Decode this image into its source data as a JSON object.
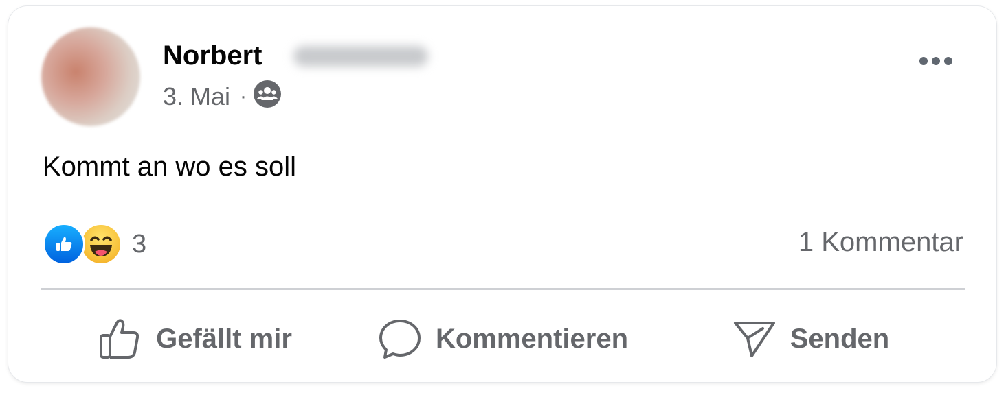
{
  "post": {
    "author_name": "Norbert",
    "date": "3. Mai",
    "separator": "·",
    "audience_icon": "group-icon",
    "more_icon": "more-options-icon",
    "text": "Kommt an wo es soll"
  },
  "stats": {
    "reaction_icons": [
      "like-reaction-icon",
      "haha-reaction-icon"
    ],
    "reaction_count": "3",
    "comment_count": "1 Kommentar"
  },
  "actions": {
    "like_label": "Gefällt mir",
    "comment_label": "Kommentieren",
    "send_label": "Senden"
  },
  "colors": {
    "text_primary": "#050505",
    "text_secondary": "#65676b",
    "divider": "#ced0d4",
    "like_blue": "#0866ff"
  }
}
